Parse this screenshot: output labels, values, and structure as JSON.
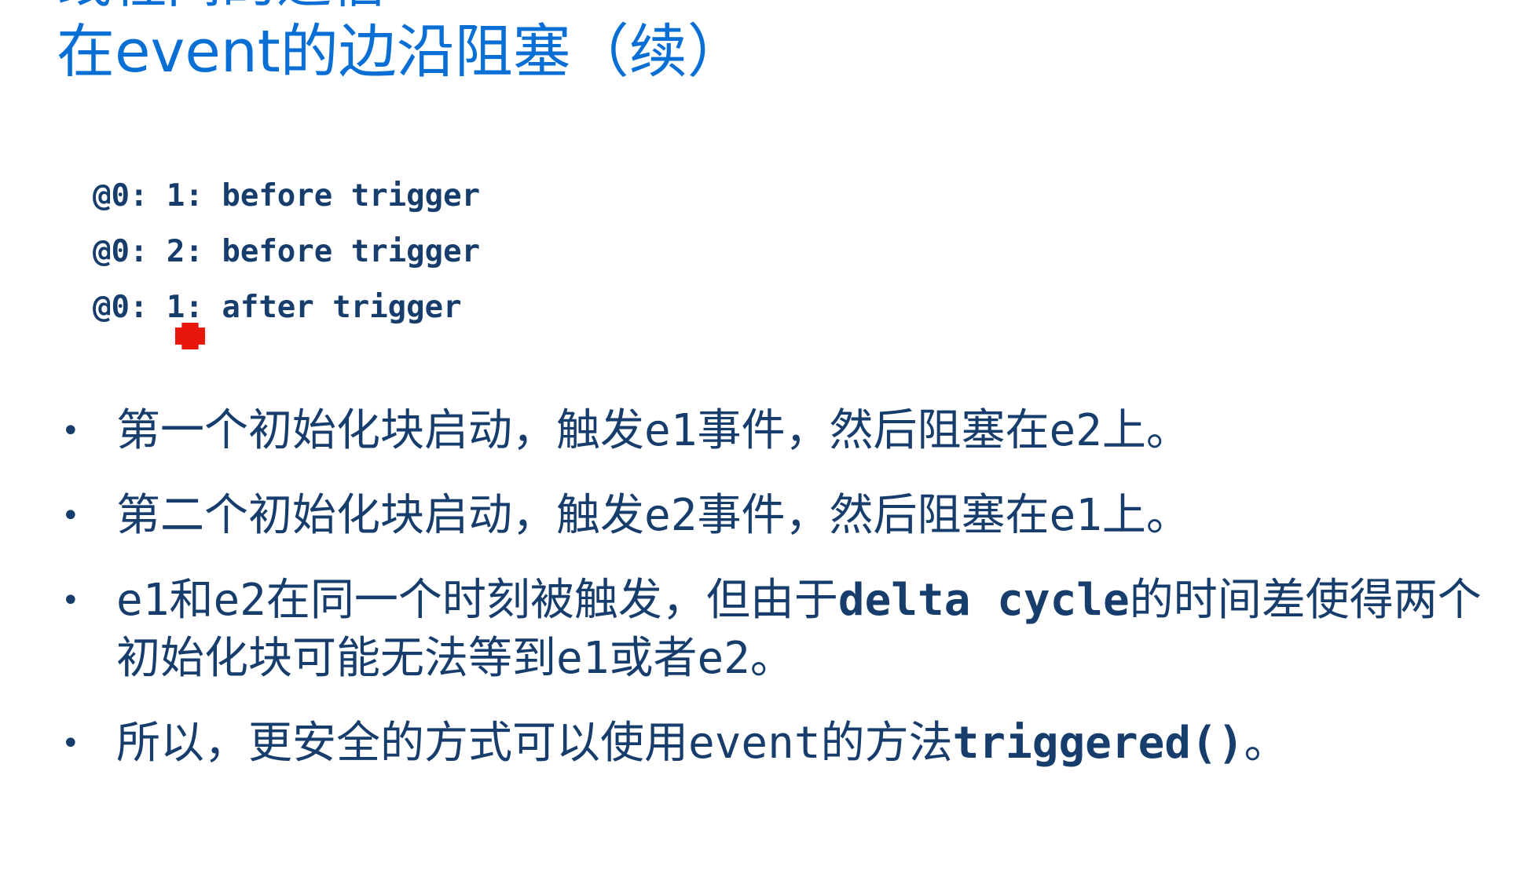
{
  "slide": {
    "title_partial": "线程间的通信",
    "title": "在event的边沿阻塞（续）",
    "code_lines": [
      "@0: 1: before trigger",
      "@0: 2: before trigger",
      "@0: 1: after trigger"
    ],
    "bullets": [
      {
        "segments": [
          "第一个初始化块启动，触发",
          "e1",
          "事件，然后阻塞在",
          "e2",
          "上。"
        ]
      },
      {
        "segments": [
          "第二个初始化块启动，触发",
          "e2",
          "事件，然后阻塞在",
          "e1",
          "上。"
        ]
      },
      {
        "segments": [
          "e1",
          "和",
          "e2",
          "在同一个时刻被触发，但由于",
          "delta cycle",
          "的时间差使得两个初始化块可能无法等到",
          "e1",
          "或者",
          "e2",
          "。"
        ]
      },
      {
        "segments": [
          "所以，更安全的方式可以使用",
          "event",
          "的方法",
          "triggered()",
          "。"
        ]
      }
    ],
    "bullet_glyph": "•"
  },
  "colors": {
    "title": "#0a6fd4",
    "body": "#163d6b",
    "cursor": "#e8170d",
    "background": "#ffffff"
  }
}
